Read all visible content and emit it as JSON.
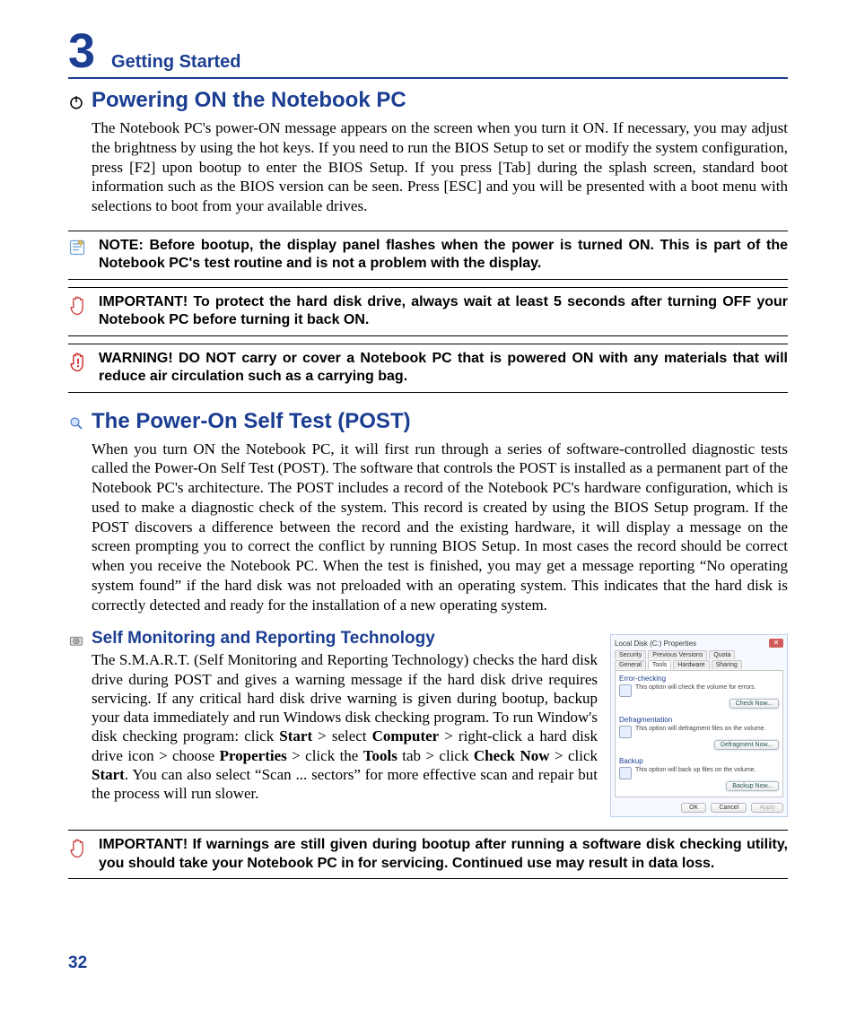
{
  "chapter": {
    "number": "3",
    "title": "Getting Started"
  },
  "section_power": {
    "heading": "Powering ON the Notebook PC",
    "paragraph": "The Notebook PC's power-ON message appears on the screen when you turn it ON. If necessary, you may adjust the brightness by using the hot keys. If you need to run the BIOS Setup to set or modify the system configuration, press [F2] upon bootup to enter the BIOS Setup. If you press [Tab] during the splash screen, standard boot information such as the BIOS version can be seen. Press [ESC] and you will be presented with a boot menu with selections to boot from your available drives."
  },
  "callouts": {
    "note": "NOTE:  Before bootup, the display panel flashes when the power is turned ON. This is part of the Notebook PC's test routine and is not a problem with the display.",
    "important1": "IMPORTANT!  To protect the hard disk drive, always wait at least 5 seconds after turning OFF your Notebook PC before turning it back ON.",
    "warning": "WARNING! DO NOT carry or cover a Notebook PC that is powered ON with any materials that will reduce air circulation such as a carrying bag.",
    "important2": "IMPORTANT! If warnings are still given during bootup after running a software disk checking utility, you should take your Notebook PC in for servicing. Continued use may result in data loss."
  },
  "section_post": {
    "heading": "The Power-On Self Test (POST)",
    "paragraph": "When you turn ON the Notebook PC, it will first run through a series of software-controlled diagnostic tests called the Power-On Self Test (POST). The software that controls the POST is installed as a permanent part of the Notebook PC's architecture. The POST includes a record of the Notebook PC's hardware configuration, which is used to make a diagnostic check of the system. This record is created by using the BIOS Setup program. If the POST discovers a difference between the record and the existing hardware, it will display a message on the screen prompting you to correct the conflict by running BIOS Setup. In most cases the record should be correct when you receive the Notebook PC. When the test is finished, you may get a message reporting “No operating system found” if the hard disk was not preloaded with an operating system. This indicates that the hard disk is correctly detected and ready for the installation of a new operating system."
  },
  "section_smart": {
    "heading": "Self Monitoring and Reporting Technology",
    "para_pre": "The S.M.A.R.T. (Self Monitoring and Reporting Technology) checks the hard disk drive during POST and gives a warning message if the hard disk drive requires servicing. If any critical hard disk drive warning is given during bootup, backup your data immediately and run Windows disk checking program. To run Window's disk checking program: click ",
    "bold1": "Start",
    "mid1": " > select ",
    "bold2": "Computer",
    "mid2": " > right-click a hard disk drive icon > choose ",
    "bold3": "Properties",
    "mid3": " > click the ",
    "bold4": "Tools",
    "mid4": " tab > click ",
    "bold5": "Check Now",
    "mid5": " > click ",
    "bold6": "Start",
    "para_post": ". You can also select “Scan ... sectors” for more effective scan and repair but the process will run slower."
  },
  "thumb": {
    "title": "Local Disk (C:) Properties",
    "tabs_row1": [
      "Security",
      "Previous Versions",
      "Quota"
    ],
    "tabs_row2": [
      "General",
      "Tools",
      "Hardware",
      "Sharing"
    ],
    "group1": {
      "title": "Error-checking",
      "desc": "This option will check the volume for errors.",
      "btn": "Check Now..."
    },
    "group2": {
      "title": "Defragmentation",
      "desc": "This option will defragment files on the volume.",
      "btn": "Defragment Now..."
    },
    "group3": {
      "title": "Backup",
      "desc": "This option will back up files on the volume.",
      "btn": "Backup Now..."
    },
    "footer": {
      "ok": "OK",
      "cancel": "Cancel",
      "apply": "Apply"
    }
  },
  "page_number": "32",
  "colors": {
    "brand": "#1b3e92"
  }
}
